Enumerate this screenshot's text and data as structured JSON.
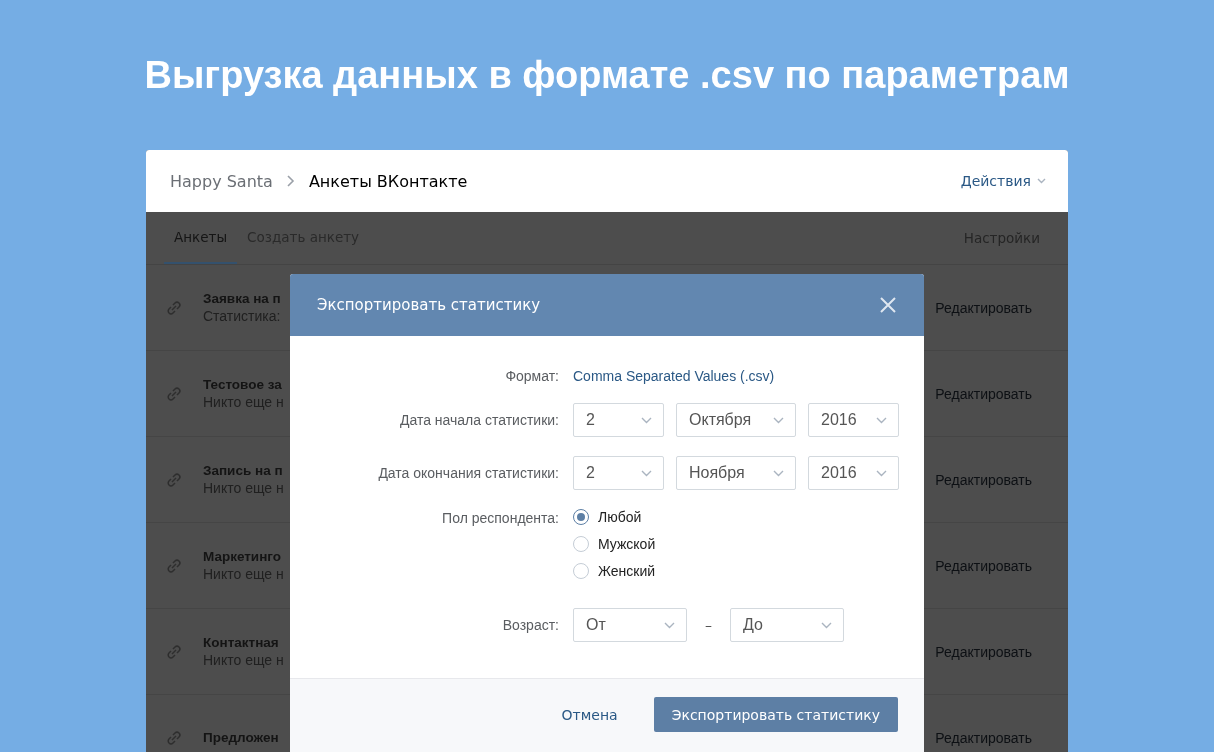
{
  "heading": "Выгрузка данных в формате .csv по параметрам",
  "card": {
    "breadcrumb": [
      "Happy Santa",
      "Анкеты ВКонтакте"
    ],
    "actions": "Действия",
    "tabs": [
      {
        "label": "Анкеты",
        "selected": true
      },
      {
        "label": "Создать анкету",
        "selected": false
      }
    ],
    "settings": "Настройки",
    "rows": [
      {
        "title": "Заявка на п",
        "subtitle": "Статистика:",
        "action": "Редактировать"
      },
      {
        "title": "Тестовое за",
        "subtitle": "Никто еще н",
        "action": "Редактировать"
      },
      {
        "title": "Запись на п",
        "subtitle": "Никто еще н",
        "action": "Редактировать"
      },
      {
        "title": "Маркетинго",
        "subtitle": "Никто еще н",
        "action": "Редактировать"
      },
      {
        "title": "Контактная",
        "subtitle": "Никто еще н",
        "action": "Редактировать"
      },
      {
        "title": "Предложен",
        "action": "Редактировать"
      }
    ]
  },
  "dialog": {
    "title": "Экспортировать статистику",
    "format": {
      "label": "Формат:",
      "value": "Comma Separated Values (.csv)"
    },
    "dates": [
      {
        "label": "Дата начала статистики:",
        "day": "2",
        "month": "Октября",
        "year": "2016"
      },
      {
        "label": "Дата окончания статистики:",
        "day": "2",
        "month": "Ноября",
        "year": "2016"
      }
    ],
    "gender": {
      "label": "Пол респондента:",
      "options": [
        {
          "label": "Любой",
          "selected": true
        },
        {
          "label": "Мужской",
          "selected": false
        },
        {
          "label": "Женский",
          "selected": false
        }
      ]
    },
    "age": {
      "label": "Возраст:",
      "from": "От",
      "dash": "–",
      "to": "До"
    },
    "cancel": "Отмена",
    "submit": "Экспортировать статистику"
  }
}
